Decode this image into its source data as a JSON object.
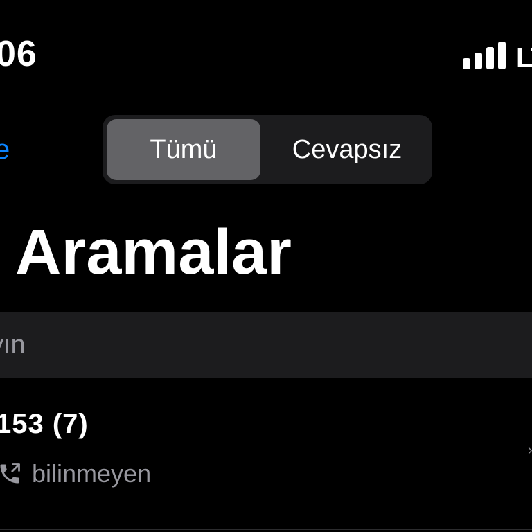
{
  "status_bar": {
    "time": "06",
    "carrier": "LT",
    "signal_bars": 4
  },
  "nav": {
    "edit_label": "e",
    "segments": [
      {
        "label": "Tümü",
        "selected": true
      },
      {
        "label": "Cevapsız",
        "selected": false
      }
    ]
  },
  "page": {
    "title": "Aramalar"
  },
  "search": {
    "placeholder": "yın"
  },
  "calls": [
    {
      "number": "153 (7)",
      "type_icon": "phone-outgoing-icon",
      "subtitle": "bilinmeyen"
    }
  ],
  "colors": {
    "background": "#000000",
    "accent": "#0a84ff",
    "segment_track": "#1c1c1e",
    "segment_selected": "#636366",
    "secondary_text": "#98989f",
    "search_background": "#1c1c1e"
  }
}
